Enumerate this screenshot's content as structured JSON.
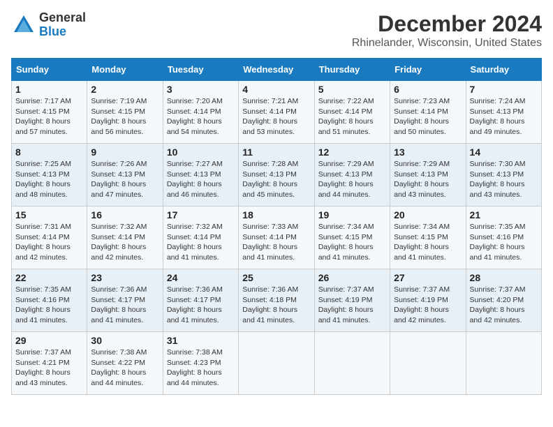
{
  "header": {
    "logo": {
      "general": "General",
      "blue": "Blue"
    },
    "title": "December 2024",
    "location": "Rhinelander, Wisconsin, United States"
  },
  "calendar": {
    "days_of_week": [
      "Sunday",
      "Monday",
      "Tuesday",
      "Wednesday",
      "Thursday",
      "Friday",
      "Saturday"
    ],
    "weeks": [
      [
        {
          "day": "1",
          "sunrise": "7:17 AM",
          "sunset": "4:15 PM",
          "daylight": "8 hours and 57 minutes."
        },
        {
          "day": "2",
          "sunrise": "7:19 AM",
          "sunset": "4:15 PM",
          "daylight": "8 hours and 56 minutes."
        },
        {
          "day": "3",
          "sunrise": "7:20 AM",
          "sunset": "4:14 PM",
          "daylight": "8 hours and 54 minutes."
        },
        {
          "day": "4",
          "sunrise": "7:21 AM",
          "sunset": "4:14 PM",
          "daylight": "8 hours and 53 minutes."
        },
        {
          "day": "5",
          "sunrise": "7:22 AM",
          "sunset": "4:14 PM",
          "daylight": "8 hours and 51 minutes."
        },
        {
          "day": "6",
          "sunrise": "7:23 AM",
          "sunset": "4:14 PM",
          "daylight": "8 hours and 50 minutes."
        },
        {
          "day": "7",
          "sunrise": "7:24 AM",
          "sunset": "4:13 PM",
          "daylight": "8 hours and 49 minutes."
        }
      ],
      [
        {
          "day": "8",
          "sunrise": "7:25 AM",
          "sunset": "4:13 PM",
          "daylight": "8 hours and 48 minutes."
        },
        {
          "day": "9",
          "sunrise": "7:26 AM",
          "sunset": "4:13 PM",
          "daylight": "8 hours and 47 minutes."
        },
        {
          "day": "10",
          "sunrise": "7:27 AM",
          "sunset": "4:13 PM",
          "daylight": "8 hours and 46 minutes."
        },
        {
          "day": "11",
          "sunrise": "7:28 AM",
          "sunset": "4:13 PM",
          "daylight": "8 hours and 45 minutes."
        },
        {
          "day": "12",
          "sunrise": "7:29 AM",
          "sunset": "4:13 PM",
          "daylight": "8 hours and 44 minutes."
        },
        {
          "day": "13",
          "sunrise": "7:29 AM",
          "sunset": "4:13 PM",
          "daylight": "8 hours and 43 minutes."
        },
        {
          "day": "14",
          "sunrise": "7:30 AM",
          "sunset": "4:13 PM",
          "daylight": "8 hours and 43 minutes."
        }
      ],
      [
        {
          "day": "15",
          "sunrise": "7:31 AM",
          "sunset": "4:14 PM",
          "daylight": "8 hours and 42 minutes."
        },
        {
          "day": "16",
          "sunrise": "7:32 AM",
          "sunset": "4:14 PM",
          "daylight": "8 hours and 42 minutes."
        },
        {
          "day": "17",
          "sunrise": "7:32 AM",
          "sunset": "4:14 PM",
          "daylight": "8 hours and 41 minutes."
        },
        {
          "day": "18",
          "sunrise": "7:33 AM",
          "sunset": "4:14 PM",
          "daylight": "8 hours and 41 minutes."
        },
        {
          "day": "19",
          "sunrise": "7:34 AM",
          "sunset": "4:15 PM",
          "daylight": "8 hours and 41 minutes."
        },
        {
          "day": "20",
          "sunrise": "7:34 AM",
          "sunset": "4:15 PM",
          "daylight": "8 hours and 41 minutes."
        },
        {
          "day": "21",
          "sunrise": "7:35 AM",
          "sunset": "4:16 PM",
          "daylight": "8 hours and 41 minutes."
        }
      ],
      [
        {
          "day": "22",
          "sunrise": "7:35 AM",
          "sunset": "4:16 PM",
          "daylight": "8 hours and 41 minutes."
        },
        {
          "day": "23",
          "sunrise": "7:36 AM",
          "sunset": "4:17 PM",
          "daylight": "8 hours and 41 minutes."
        },
        {
          "day": "24",
          "sunrise": "7:36 AM",
          "sunset": "4:17 PM",
          "daylight": "8 hours and 41 minutes."
        },
        {
          "day": "25",
          "sunrise": "7:36 AM",
          "sunset": "4:18 PM",
          "daylight": "8 hours and 41 minutes."
        },
        {
          "day": "26",
          "sunrise": "7:37 AM",
          "sunset": "4:19 PM",
          "daylight": "8 hours and 41 minutes."
        },
        {
          "day": "27",
          "sunrise": "7:37 AM",
          "sunset": "4:19 PM",
          "daylight": "8 hours and 42 minutes."
        },
        {
          "day": "28",
          "sunrise": "7:37 AM",
          "sunset": "4:20 PM",
          "daylight": "8 hours and 42 minutes."
        }
      ],
      [
        {
          "day": "29",
          "sunrise": "7:37 AM",
          "sunset": "4:21 PM",
          "daylight": "8 hours and 43 minutes."
        },
        {
          "day": "30",
          "sunrise": "7:38 AM",
          "sunset": "4:22 PM",
          "daylight": "8 hours and 44 minutes."
        },
        {
          "day": "31",
          "sunrise": "7:38 AM",
          "sunset": "4:23 PM",
          "daylight": "8 hours and 44 minutes."
        },
        null,
        null,
        null,
        null
      ]
    ]
  }
}
